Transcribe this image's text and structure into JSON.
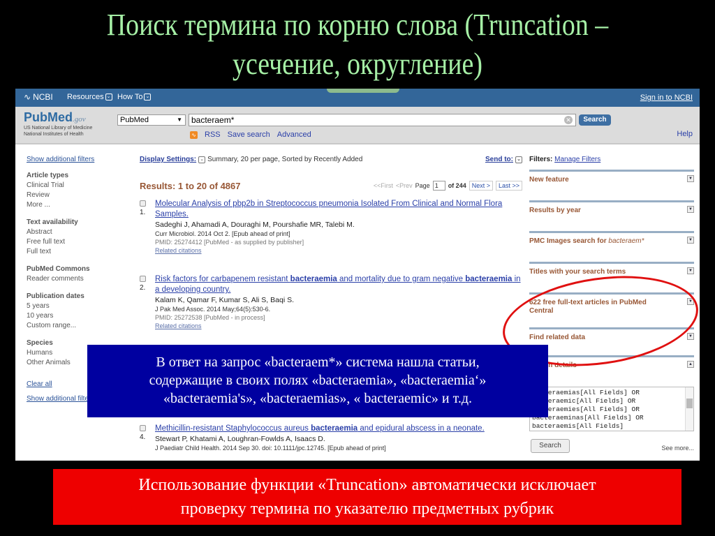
{
  "slide": {
    "title_line1": "Поиск термина по корню слова (Truncation –",
    "title_line2": "усечение, округление)",
    "blue_callout": [
      "В ответ на запрос «bacteraem*» система нашла статьи,",
      "содержащие в своих полях «bacteraemia», «bacteraemia‘»",
      "«bacteraemia's», «bacteraemias», « bacteraemic» и т.д."
    ],
    "red_callout": [
      "Использование функции «Truncation» автоматически исключает",
      "проверку термина по указателю предметных рубрик"
    ]
  },
  "ncbi_bar": {
    "logo": "NCBI",
    "resources": "Resources",
    "howto": "How To",
    "signin": "Sign in to NCBI"
  },
  "search": {
    "logo_main": "PubMed",
    "logo_gov": ".gov",
    "logo_sub1": "US National Library of Medicine",
    "logo_sub2": "National Institutes of Health",
    "database": "PubMed",
    "term": "bacteraem*",
    "search_button": "Search",
    "rss": "RSS",
    "save_search": "Save search",
    "advanced": "Advanced",
    "help": "Help"
  },
  "left_filters": {
    "show_additional": "Show additional filters",
    "groups": [
      {
        "title": "Article types",
        "items": [
          "Clinical Trial",
          "Review",
          "More ..."
        ]
      },
      {
        "title": "Text availability",
        "items": [
          "Abstract",
          "Free full text",
          "Full text"
        ]
      },
      {
        "title": "PubMed Commons",
        "items": [
          "Reader comments"
        ]
      },
      {
        "title": "Publication dates",
        "items": [
          "5 years",
          "10 years",
          "Custom range..."
        ]
      },
      {
        "title": "Species",
        "items": [
          "Humans",
          "Other Animals"
        ]
      }
    ],
    "clear_all": "Clear all",
    "show_additional_bottom": "Show additional filters"
  },
  "results": {
    "display_settings_label": "Display Settings:",
    "display_settings_value": "Summary, 20 per page, Sorted by Recently Added",
    "send_to": "Send to:",
    "count": "Results: 1 to 20 of 4867",
    "pager": {
      "first": "<<First",
      "prev": "<Prev",
      "page_label": "Page",
      "page": "1",
      "of": "of 244",
      "next": "Next >",
      "last": "Last >>"
    },
    "items": [
      {
        "num": "1.",
        "title_parts": [
          {
            "t": "Molecular Analysis of pbp2b in Streptococcus pneumonia Isolated From Clinical and Normal Flora Samples.",
            "b": false
          }
        ],
        "authors": "Sadeghi J, Ahamadi A, Douraghi M, Pourshafie MR, Talebi M.",
        "journal": "Curr Microbiol. 2014 Oct 2. [Epub ahead of print]",
        "pmid": "PMID: 25274412 [PubMed - as supplied by publisher]",
        "related": "Related citations"
      },
      {
        "num": "2.",
        "title_parts": [
          {
            "t": "Risk factors for carbapenem resistant ",
            "b": false
          },
          {
            "t": "bacteraemia",
            "b": true
          },
          {
            "t": " and mortality due to gram negative ",
            "b": false
          },
          {
            "t": "bacteraemia",
            "b": true
          },
          {
            "t": " in a developing country.",
            "b": false
          }
        ],
        "authors": "Kalam K, Qamar F, Kumar S, Ali S, Baqi S.",
        "journal": "J Pak Med Assoc. 2014 May;64(5):530-6.",
        "pmid": "PMID: 25272538 [PubMed - in process]",
        "related": "Related citations"
      },
      {
        "num": "4.",
        "title_parts": [
          {
            "t": "Methicillin-resistant Staphylococcus aureus ",
            "b": false
          },
          {
            "t": "bacteraemia",
            "b": true
          },
          {
            "t": " and epidural abscess in a neonate.",
            "b": false
          }
        ],
        "authors": "Stewart P, Khatami A, Loughran-Fowlds A, Isaacs D.",
        "journal": "J Paediatr Child Health. 2014 Sep 30. doi: 10.1111/jpc.12745. [Epub ahead of print]"
      }
    ]
  },
  "right_panel": {
    "filters_label": "Filters:",
    "manage_filters": "Manage Filters",
    "portlets": [
      "New feature",
      "Results by year",
      "PMC Images search for",
      "Titles with your search terms",
      "622 free full-text articles in PubMed Central",
      "Find related data",
      "Search details"
    ],
    "pmc_term": "bacteraem*",
    "details_lines": [
      "bacteraemias[All Fields] OR",
      "bacteraemic[All Fields] OR",
      "bacteraemies[All Fields] OR",
      "bacteraeminas[All Fields] OR",
      "bacteraemis[All Fields]"
    ],
    "details_search": "Search",
    "see_more": "See more..."
  }
}
